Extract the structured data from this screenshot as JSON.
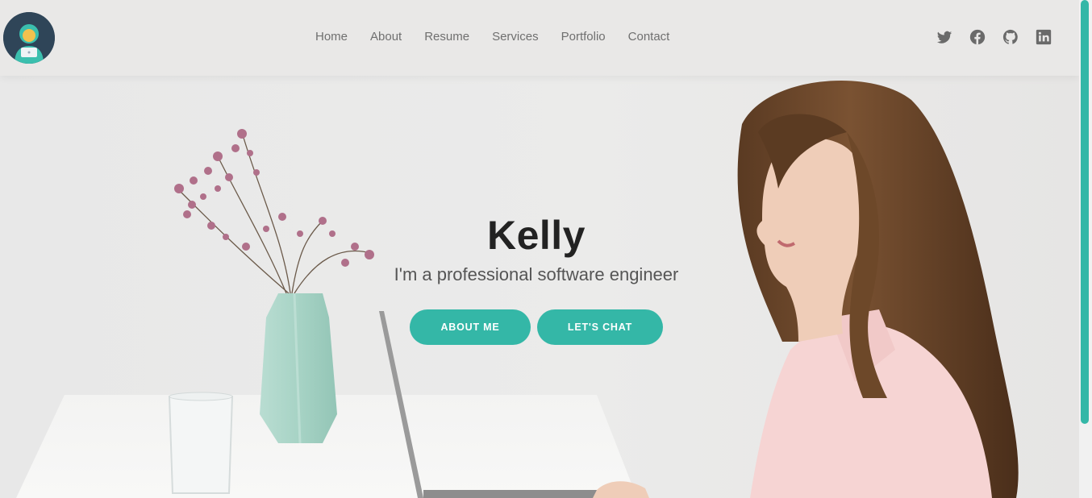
{
  "header": {
    "avatar": "developer-avatar",
    "nav": [
      "Home",
      "About",
      "Resume",
      "Services",
      "Portfolio",
      "Contact"
    ],
    "social_icons": [
      "twitter-icon",
      "facebook-icon",
      "github-icon",
      "linkedin-icon"
    ]
  },
  "hero": {
    "name": "Kelly",
    "tagline": "I'm a professional software engineer",
    "buttons": {
      "about": "ABOUT ME",
      "chat": "LET'S CHAT"
    }
  },
  "colors": {
    "accent": "#34b7a7",
    "background": "#e9e8e7",
    "avatar_bg": "#2f4558",
    "nav_text": "#6f6f6f"
  }
}
